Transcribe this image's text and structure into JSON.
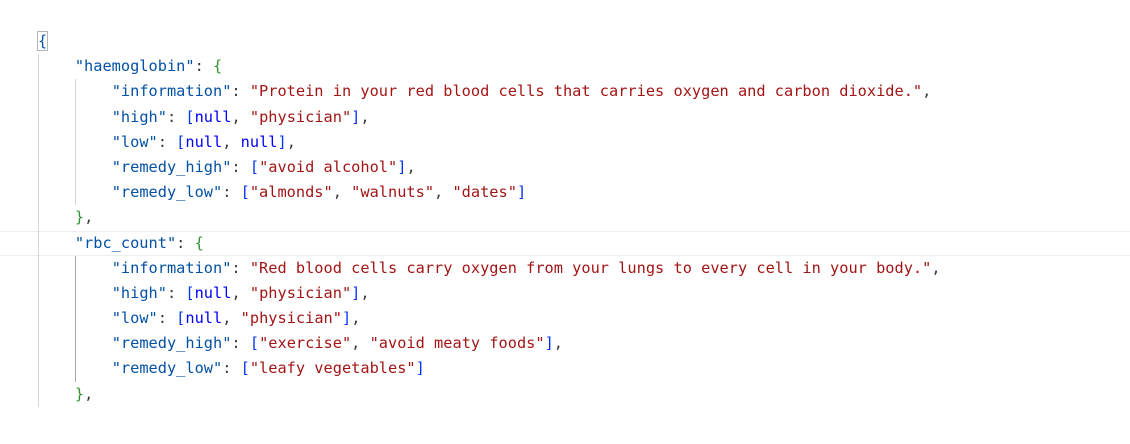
{
  "editor": {
    "root_open": "{",
    "objects": [
      {
        "key": "\"haemoglobin\"",
        "fields": [
          {
            "key": "\"information\"",
            "value": "\"Protein in your red blood cells that carries oxygen and carbon dioxide.\""
          },
          {
            "key": "\"high\"",
            "items": [
              "null",
              "\"physician\""
            ]
          },
          {
            "key": "\"low\"",
            "items": [
              "null",
              "null"
            ]
          },
          {
            "key": "\"remedy_high\"",
            "items": [
              "\"avoid alcohol\""
            ]
          },
          {
            "key": "\"remedy_low\"",
            "items": [
              "\"almonds\"",
              "\"walnuts\"",
              "\"dates\""
            ]
          }
        ]
      },
      {
        "key": "\"rbc_count\"",
        "fields": [
          {
            "key": "\"information\"",
            "value": "\"Red blood cells carry oxygen from your lungs to every cell in your body.\""
          },
          {
            "key": "\"high\"",
            "items": [
              "null",
              "\"physician\""
            ]
          },
          {
            "key": "\"low\"",
            "items": [
              "null",
              "\"physician\""
            ]
          },
          {
            "key": "\"remedy_high\"",
            "items": [
              "\"exercise\"",
              "\"avoid meaty foods\""
            ]
          },
          {
            "key": "\"remedy_low\"",
            "items": [
              "\"leafy vegetables\""
            ]
          }
        ]
      }
    ],
    "colors": {
      "key": "#0451a5",
      "string": "#a31515",
      "keyword": "#0000ff",
      "bracket_object": "#319331",
      "bracket_array": "#0431fa"
    }
  }
}
